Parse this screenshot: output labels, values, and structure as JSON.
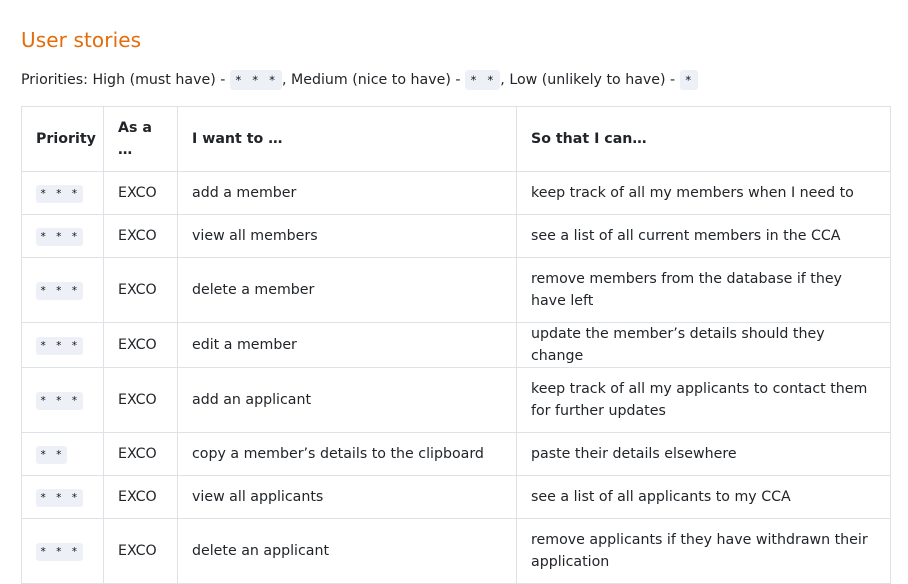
{
  "section": {
    "title": "User stories"
  },
  "priorities": {
    "prefix": "Priorities: High (must have) - ",
    "high_code": "* * *",
    "sep1": ", Medium (nice to have) - ",
    "medium_code": "* *",
    "sep2": ", Low (unlikely to have) - ",
    "low_code": "*"
  },
  "table": {
    "headers": [
      "Priority",
      "As a …",
      "I want to …",
      "So that I can…"
    ],
    "rows": [
      {
        "priority": "* * *",
        "role": "EXCO",
        "want": "add a member",
        "benefit": "keep track of all my members when I need to"
      },
      {
        "priority": "* * *",
        "role": "EXCO",
        "want": "view all members",
        "benefit": "see a list of all current members in the CCA"
      },
      {
        "priority": "* * *",
        "role": "EXCO",
        "want": "delete a member",
        "benefit": "remove members from the database if they have left"
      },
      {
        "priority": "* * *",
        "role": "EXCO",
        "want": "edit a member",
        "benefit": "update the member’s details should they change"
      },
      {
        "priority": "* * *",
        "role": "EXCO",
        "want": "add an applicant",
        "benefit": "keep track of all my applicants to contact them for further updates"
      },
      {
        "priority": "* *",
        "role": "EXCO",
        "want": "copy a member’s details to the clipboard",
        "benefit": "paste their details elsewhere"
      },
      {
        "priority": "* * *",
        "role": "EXCO",
        "want": "view all applicants",
        "benefit": "see a list of all applicants to my CCA"
      },
      {
        "priority": "* * *",
        "role": "EXCO",
        "want": "delete an applicant",
        "benefit": "remove applicants if they have withdrawn their application"
      }
    ]
  }
}
